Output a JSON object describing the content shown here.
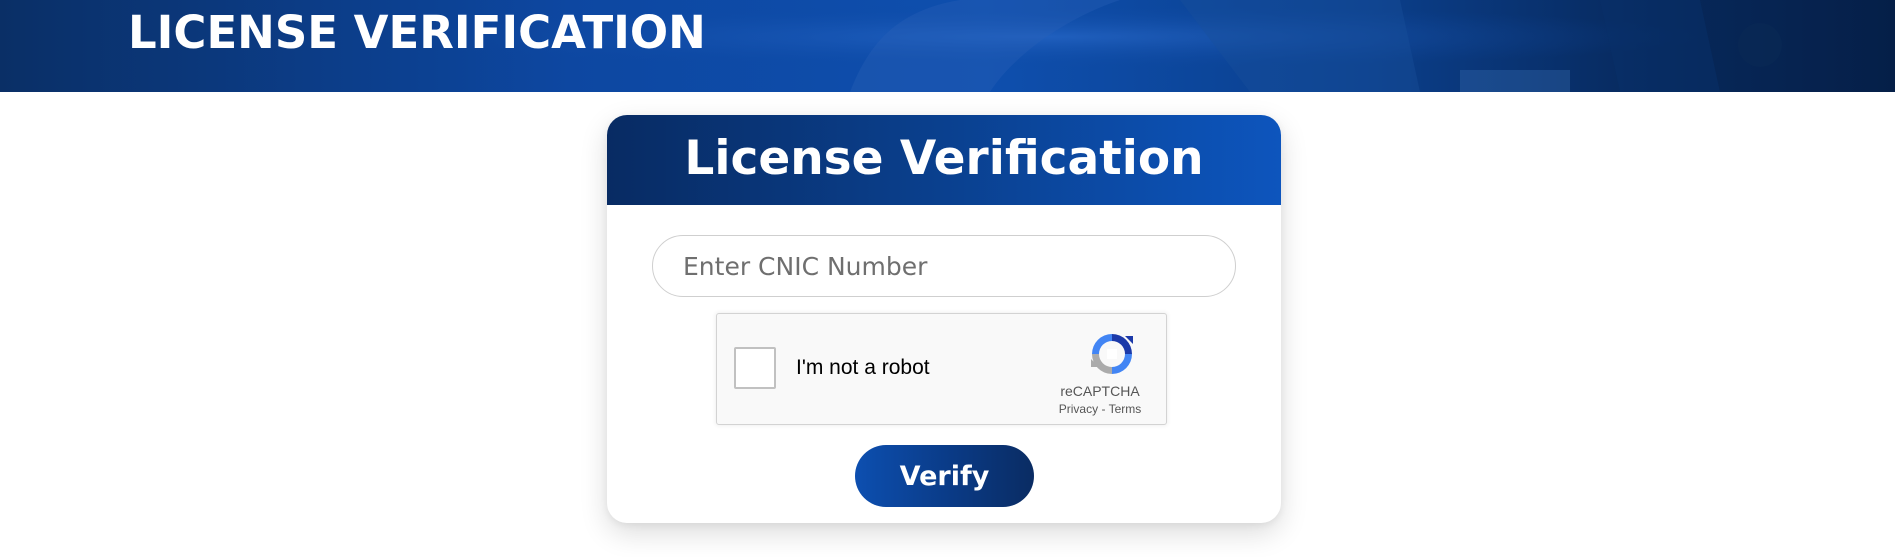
{
  "banner": {
    "title": "LICENSE VERIFICATION"
  },
  "card": {
    "title": "License Verification",
    "cnic_input": {
      "placeholder": "Enter CNIC Number",
      "value": ""
    },
    "recaptcha": {
      "label": "I'm not a robot",
      "brand": "reCAPTCHA",
      "privacy": "Privacy",
      "separator": "-",
      "terms": "Terms",
      "checked": false
    },
    "verify_label": "Verify"
  },
  "colors": {
    "primary_dark": "#082b63",
    "primary": "#0d4fb0",
    "banner_blue": "#0d47a1"
  },
  "icons": {
    "recaptcha_logo": "recaptcha-logo-icon",
    "checkbox": "checkbox-icon"
  }
}
